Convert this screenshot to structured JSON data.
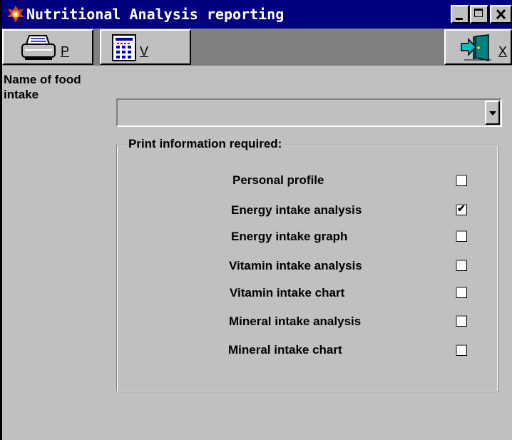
{
  "window": {
    "title": "Nutritional Analysis reporting"
  },
  "toolbar": {
    "print_letter": "P",
    "view_letter": "V",
    "exit_letter": "X"
  },
  "form": {
    "food_label": "Name of food intake",
    "food_value": ""
  },
  "print_group": {
    "legend": "Print information required:",
    "options": [
      {
        "label": "Personal profile",
        "checked": false
      },
      {
        "label": "Energy intake analysis",
        "checked": true
      },
      {
        "label": "Energy intake graph",
        "checked": false
      },
      {
        "label": "Vitamin intake analysis",
        "checked": false
      },
      {
        "label": "Vitamin intake chart",
        "checked": false
      },
      {
        "label": "Mineral intake analysis",
        "checked": false
      },
      {
        "label": "Mineral intake chart",
        "checked": false
      }
    ]
  },
  "icons": {
    "title": "app-icon",
    "print": "printer-icon",
    "view": "report-view-icon",
    "exit": "exit-door-icon"
  },
  "check_mark": "✔",
  "colors": {
    "titlebar": "#000080",
    "face": "#c0c0c0",
    "toolbar": "#808080"
  }
}
